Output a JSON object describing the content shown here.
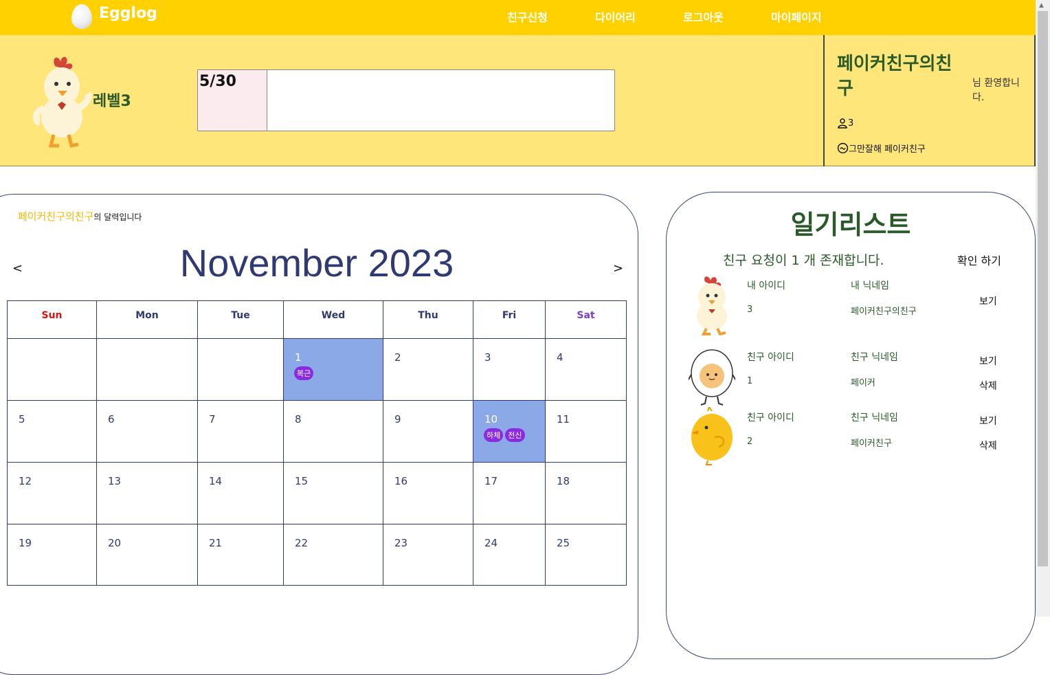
{
  "header": {
    "logo": "Egglog",
    "nav": [
      "친구신청",
      "다이어리",
      "로그아웃",
      "마이페이지"
    ]
  },
  "profile": {
    "level": "레벨3",
    "progress_text": "5/30",
    "progress_value": 5,
    "progress_max": 30,
    "username": "페이커친구의친구",
    "welcome": "님 환영합니다.",
    "friend_count": "3",
    "status": "그만잘해 페이커친구"
  },
  "calendar": {
    "owner_name": "페이커친구의친구",
    "owner_suffix": "의 달력입니다",
    "title": "November 2023",
    "prev": "<",
    "next": ">",
    "weekdays": [
      "Sun",
      "Mon",
      "Tue",
      "Wed",
      "Thu",
      "Fri",
      "Sat"
    ],
    "weeks": [
      [
        {
          "d": ""
        },
        {
          "d": ""
        },
        {
          "d": ""
        },
        {
          "d": "1",
          "hl": true,
          "tags": [
            "복근"
          ]
        },
        {
          "d": "2"
        },
        {
          "d": "3"
        },
        {
          "d": "4"
        }
      ],
      [
        {
          "d": "5"
        },
        {
          "d": "6"
        },
        {
          "d": "7"
        },
        {
          "d": "8"
        },
        {
          "d": "9"
        },
        {
          "d": "10",
          "hl": true,
          "tags": [
            "하체",
            "전신"
          ]
        },
        {
          "d": "11"
        }
      ],
      [
        {
          "d": "12"
        },
        {
          "d": "13"
        },
        {
          "d": "14"
        },
        {
          "d": "15"
        },
        {
          "d": "16"
        },
        {
          "d": "17"
        },
        {
          "d": "18"
        }
      ],
      [
        {
          "d": "19"
        },
        {
          "d": "20"
        },
        {
          "d": "21"
        },
        {
          "d": "22"
        },
        {
          "d": "23"
        },
        {
          "d": "24"
        },
        {
          "d": "25"
        }
      ]
    ]
  },
  "diary_list": {
    "title": "일기리스트",
    "request_text": "친구 요청이 1 개 존재합니다.",
    "request_button": "확인 하기",
    "items": [
      {
        "avatar": "chicken-icon",
        "id_label": "내 아이디",
        "nick_label": "내 닉네임",
        "id": "3",
        "nick": "페이커친구의친구",
        "view": "보기",
        "delete": ""
      },
      {
        "avatar": "egg-character-icon",
        "id_label": "친구 아이디",
        "nick_label": "친구 닉네임",
        "id": "1",
        "nick": "페이커",
        "view": "보기",
        "delete": "삭제"
      },
      {
        "avatar": "chick-icon",
        "id_label": "친구 아이디",
        "nick_label": "친구 닉네임",
        "id": "2",
        "nick": "페이커친구",
        "view": "보기",
        "delete": "삭제"
      }
    ]
  },
  "colors": {
    "nav_bg": "#FFD100",
    "profile_bg": "#FFE67A",
    "accent_navy": "#2f3a73",
    "highlight": "#8BA9E6",
    "tag": "#8A2BE2",
    "title_green": "#2a5a2a"
  }
}
